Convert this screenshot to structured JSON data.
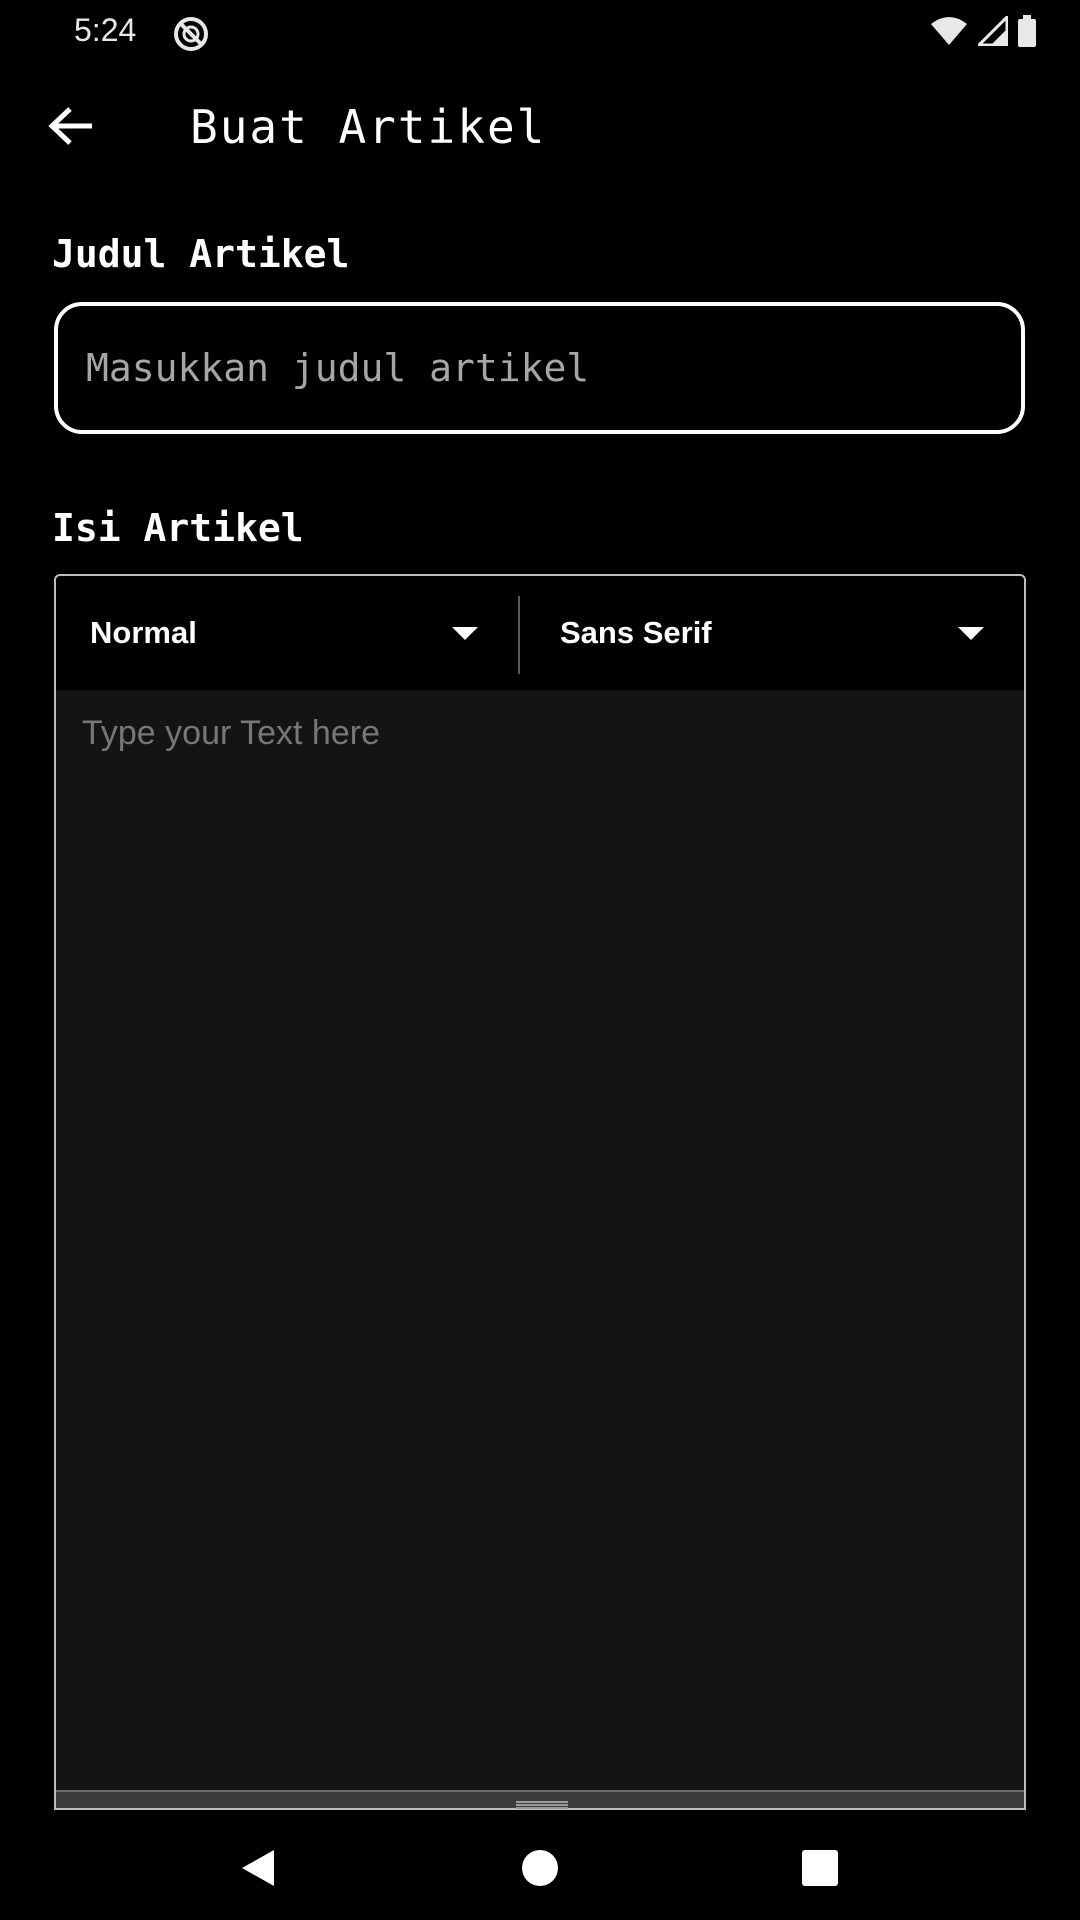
{
  "status_bar": {
    "time": "5:24",
    "icons": [
      "dnd-icon",
      "wifi-icon",
      "signal-icon",
      "battery-icon"
    ]
  },
  "app_bar": {
    "back_icon": "arrow-left-icon",
    "title": "Buat Artikel"
  },
  "form": {
    "title_label": "Judul Artikel",
    "title_placeholder": "Masukkan judul artikel",
    "title_value": "",
    "content_label": "Isi Artikel"
  },
  "editor": {
    "size_dropdown": {
      "selected": "Normal"
    },
    "font_dropdown": {
      "selected": "Sans Serif"
    },
    "placeholder": "Type your Text here"
  },
  "nav_bar": {
    "icons": [
      "nav-back-icon",
      "nav-home-icon",
      "nav-recents-icon"
    ]
  },
  "colors": {
    "background": "#000000",
    "text": "#ffffff",
    "placeholder": "#a6a6a6",
    "editor_background": "#141414"
  }
}
